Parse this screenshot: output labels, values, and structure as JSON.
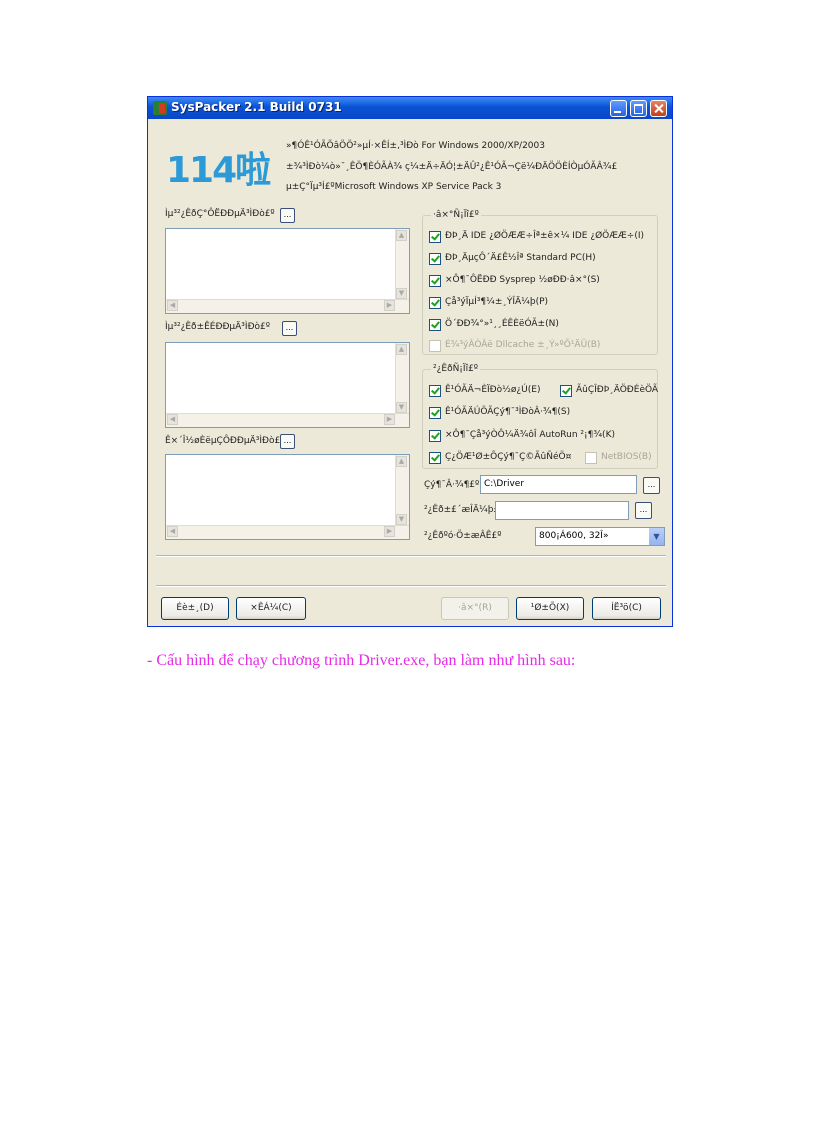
{
  "window": {
    "title": "SysPacker 2.1 Build 0731",
    "logo_text": "114啦",
    "info_lines": [
      "»¶Ó­Ê¹ÓÃÕâÖÖ²»µÍ·×ÊÍ±,³ÌÐò For Windows 2000/XP/2003",
      "±¾³ÌÐò¼ò»¯¸ÊÖ¶ÈÓÃÀ¾ ç¼±Ä÷ÄÓ¦±ÄÛ²¿Ê¹ÓÃ¬Çë¼ÐÄÖÖÈÍÒµÓÃÂ¾£",
      "µ±Ç°Ïµ³Í£ºMicrosoft Windows XP Service Pack 3"
    ]
  },
  "left": {
    "label1": "Ìµ³²¿ÊðÇ°ÔËÐÐµÄ³ÌÐò£º",
    "label2": "Ìµ³²¿Êð±ÊÉÐÐµÄ³ÌÐò£º",
    "label3": "Ê×´Î½øÈëµÇÔÐÐµÄ³ÌÐò£º",
    "browse_label": "...",
    "scroll_up": "▲",
    "scroll_down": "▼",
    "scroll_left": "◀",
    "scroll_right": "▶"
  },
  "options_group": {
    "title": "·â×°Ñ¡Ïî£º",
    "items": [
      {
        "label": "ÐÞ¸Ä IDE ¿ØÖÆÆ÷Îª±ê×¼ IDE ¿ØÖÆÆ÷(I)",
        "checked": true,
        "disabled": false
      },
      {
        "label": "ÐÞ¸ÄµçÔ´Ä£Ê½Îª Standard PC(H)",
        "checked": true,
        "disabled": false
      },
      {
        "label": "×Ô¶¯ÔËÐÐ Sysprep ½øÐÐ·â×°(S)",
        "checked": true,
        "disabled": false
      },
      {
        "label": "Çå³ýÏµÍ³¶¼±¸ÝÎÄ¼þ(P)",
        "checked": true,
        "disabled": false
      },
      {
        "label": "Ö´ÐÐ¾°»¹¸¸ÉÊÈëÓÃ±(N)",
        "checked": true,
        "disabled": false
      },
      {
        "label": "É¾³ýÂÒÂë Dllcache ±¸Ý»ºÕ¹ÄÜ(B)",
        "checked": false,
        "disabled": true
      }
    ]
  },
  "deploy_group": {
    "title": "²¿ÊðÑ¡Ïî£º",
    "items": [
      {
        "label": "Ê¹ÓÃÄ¬ÈÏÐò½ø¿Ú(E)",
        "checked": true,
        "disabled": false
      },
      {
        "label": "Ê¹ÓÃÄÚÖÃÇý¶¯³ÌÐòÂ·¾¶(S)",
        "checked": true,
        "disabled": false
      },
      {
        "label": "×Ô¶¯Çå³ýÒÔ¼Ä¾ôÎ AutoRun ²¡¶¾(K)",
        "checked": true,
        "disabled": false
      },
      {
        "label": "Ç¿ÖÆ¹Ø±ÕÇý¶¯Ç©ÃûÑéÖ¤",
        "checked": true,
        "disabled": false
      }
    ],
    "extra_item": {
      "label": "ÃûÇÎÐÞ¸ÄÖÐÉèÖÃ",
      "checked": true
    },
    "netbios": {
      "label": "NetBIOS(B)",
      "checked": false,
      "disabled": true
    }
  },
  "fields": {
    "driver_path_label": "Çý¶¯Â·¾¶£º",
    "driver_path_value": "C:\\Driver",
    "second_label": "²¿Êð±£´æÎÄ¼þ£º",
    "second_value": "",
    "resolution_label": "²¿Êðºó·Ö±æÂÊ£º",
    "resolution_value": "800¡Á600, 32Î»",
    "browse_label": "...",
    "dropdown_arrow": "▼"
  },
  "buttons": {
    "about": "Éè±¸(D)",
    "help": "×ÊÁ¼(C)",
    "pack": "·â×°(R)",
    "close": "¹Ø±Õ(X)",
    "cancel": "ÍË³ö(C)"
  },
  "caption": "- Cấu hình để chạy chương trình Driver.exe, bạn làm như hình sau:"
}
